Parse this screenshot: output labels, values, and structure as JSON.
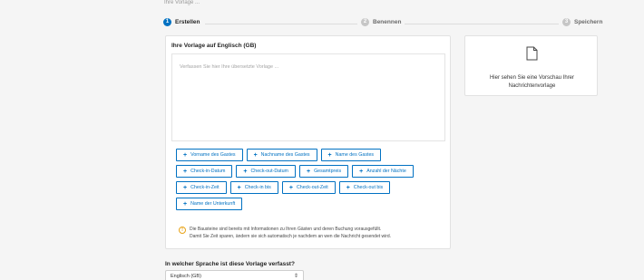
{
  "top_cutoff": "Ihre Vorlage ...",
  "stepper": {
    "steps": [
      {
        "number": "1",
        "label": "Erstellen"
      },
      {
        "number": "2",
        "label": "Benennen"
      },
      {
        "number": "3",
        "label": "Speichern"
      }
    ],
    "active_color": "#0071c2"
  },
  "editor": {
    "title": "Ihre Vorlage auf Englisch (GB)",
    "placeholder": "Verfassen Sie hier Ihre übersetzte Vorlage ..."
  },
  "chips": {
    "rows": [
      [
        "Vorname des Gastes",
        "Nachname des Gastes",
        "Name des Gastes"
      ],
      [
        "Check-in-Datum",
        "Check-out-Datum",
        "Gesamtpreis",
        "Anzahl der Nächte"
      ],
      [
        "Check-in-Zeit",
        "Check-in bis",
        "Check-out-Zeit",
        "Check-out bis"
      ],
      [
        "Name der Unterkunft"
      ]
    ]
  },
  "info": {
    "icon": "!",
    "line1": "Die Bausteine sind bereits mit Informationen zu Ihren Gästen und deren Buchung vorausgefüllt.",
    "line2": "Damit Sie Zeit sparen, ändern sie sich automatisch je nachdem an wen die Nachricht gesendet wird."
  },
  "preview": {
    "text": "Hier sehen Sie eine Vorschau Ihrer Nachrichtenvorlage"
  },
  "language": {
    "question": "In welcher Sprache ist diese Vorlage verfasst?",
    "selected": "Englisch (GB)"
  }
}
